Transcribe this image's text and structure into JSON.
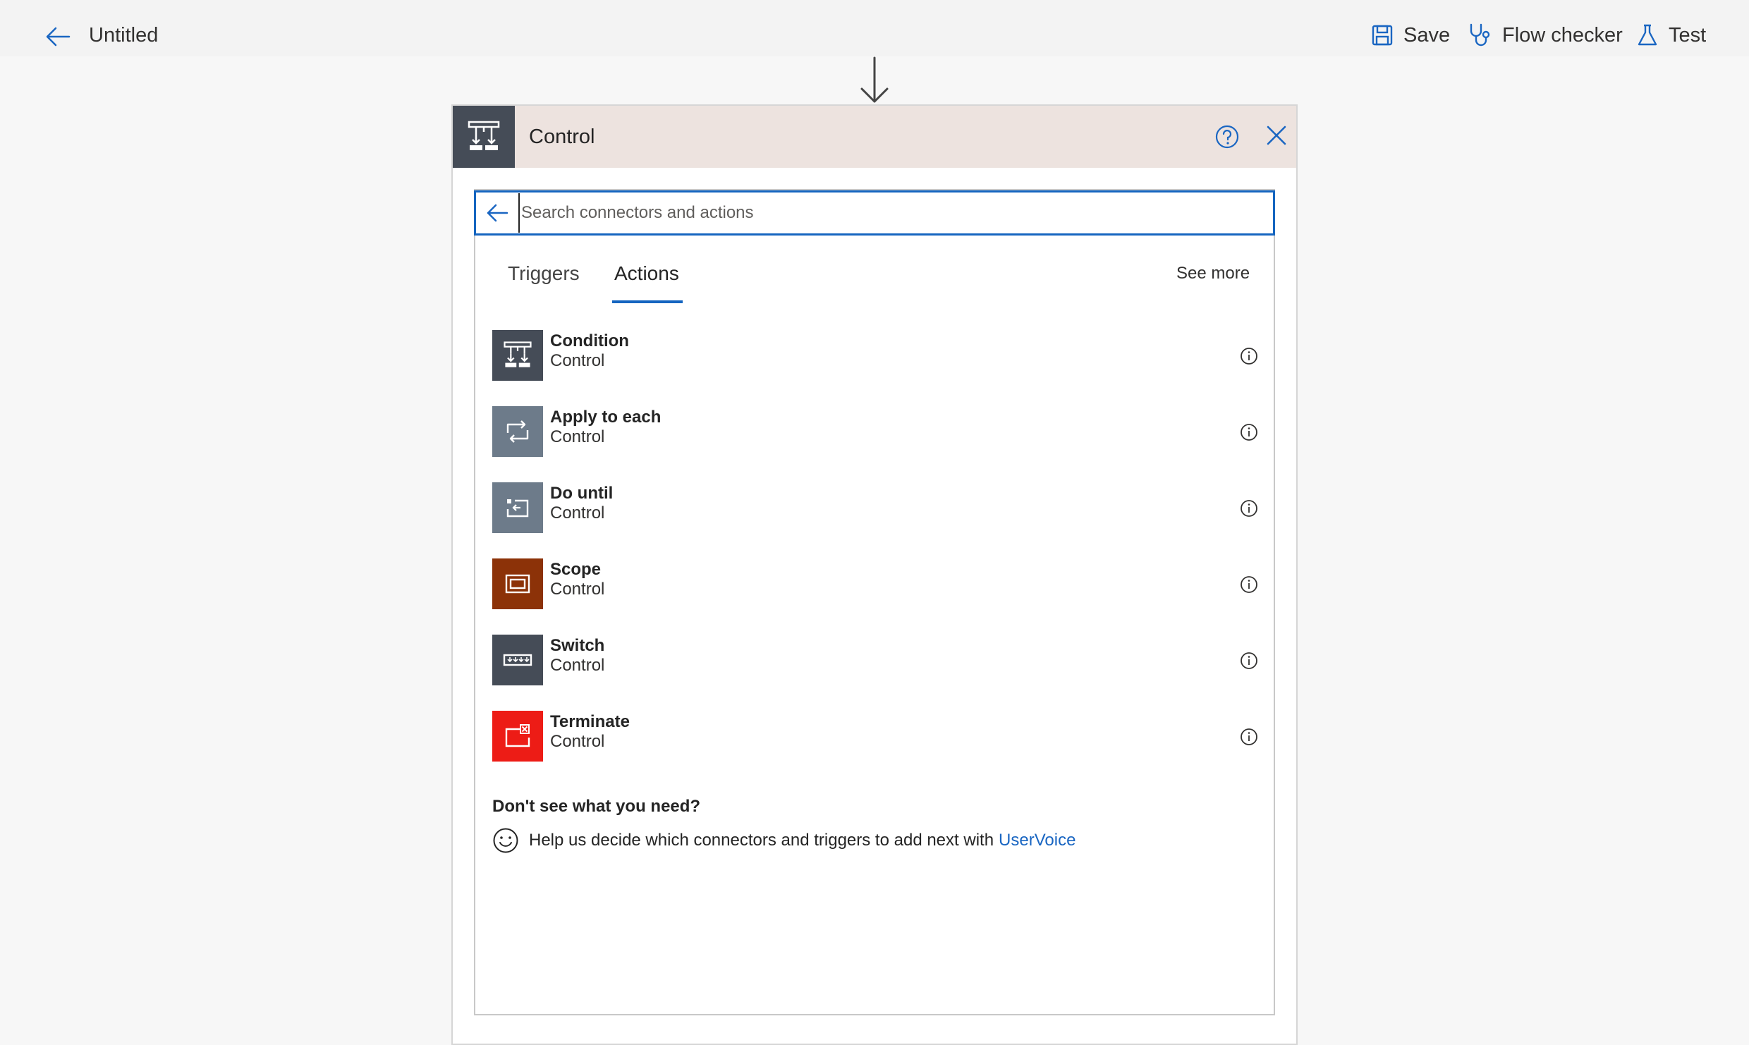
{
  "header": {
    "title": "Untitled",
    "commands": {
      "save": "Save",
      "flow_checker": "Flow checker",
      "test": "Test"
    }
  },
  "panel": {
    "title": "Control",
    "search": {
      "placeholder": "Search connectors and actions",
      "value": ""
    },
    "tabs": [
      {
        "label": "Triggers",
        "selected": false
      },
      {
        "label": "Actions",
        "selected": true
      }
    ],
    "see_more": "See more",
    "actions": [
      {
        "name": "Condition",
        "connector": "Control",
        "icon": "condition-icon",
        "color": "#454c57"
      },
      {
        "name": "Apply to each",
        "connector": "Control",
        "icon": "loop-icon",
        "color": "#6d7b8a"
      },
      {
        "name": "Do until",
        "connector": "Control",
        "icon": "do-until-icon",
        "color": "#6d7b8a"
      },
      {
        "name": "Scope",
        "connector": "Control",
        "icon": "scope-icon",
        "color": "#8c3208"
      },
      {
        "name": "Switch",
        "connector": "Control",
        "icon": "switch-icon",
        "color": "#454c57"
      },
      {
        "name": "Terminate",
        "connector": "Control",
        "icon": "terminate-icon",
        "color": "#ed1c16"
      }
    ],
    "footer": {
      "heading": "Don't see what you need?",
      "text": "Help us decide which connectors and triggers to add next with",
      "link": "UserVoice"
    }
  },
  "colors": {
    "accent": "#1565c0",
    "header_bg": "#ede3df",
    "page_bg": "#f7f7f7"
  }
}
